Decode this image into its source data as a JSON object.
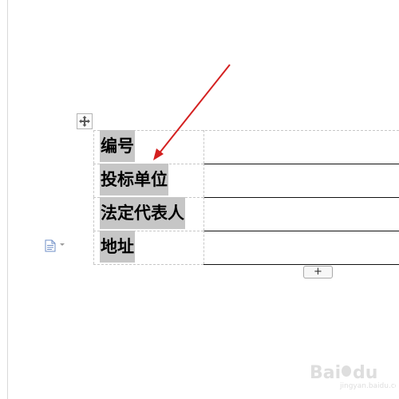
{
  "table": {
    "rows": [
      {
        "label": "编号",
        "value": ""
      },
      {
        "label": "投标单位",
        "value": ""
      },
      {
        "label": "法定代表人",
        "value": ""
      },
      {
        "label": "地址",
        "value": ""
      }
    ]
  },
  "add_row_button": {
    "label": "+"
  },
  "icons": {
    "move_handle": "move-arrows-icon",
    "paste_options": "document-icon",
    "annotation": "red-arrow-icon"
  },
  "colors": {
    "selection_highlight": "#c6c6c6",
    "annotation_arrow": "#d42020",
    "table_border": "#111111",
    "gridline": "#c7c7c7"
  },
  "watermark": {
    "brand": "Bai",
    "brand_suffix": "du",
    "site": "jingyan.baidu.com"
  }
}
